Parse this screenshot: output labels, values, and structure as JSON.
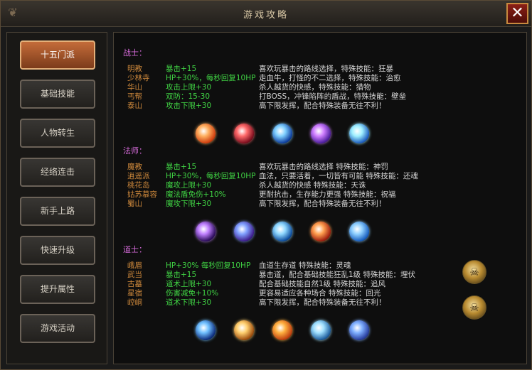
{
  "window": {
    "title": "游戏攻略",
    "close_label": "✕"
  },
  "sidebar": {
    "items": [
      {
        "label": "十五门派",
        "active": true
      },
      {
        "label": "基础技能"
      },
      {
        "label": "人物转生"
      },
      {
        "label": "经络连击"
      },
      {
        "label": "新手上路"
      },
      {
        "label": "快速升级"
      },
      {
        "label": "提升属性"
      },
      {
        "label": "游戏活动"
      }
    ]
  },
  "sections": [
    {
      "title": "战士：",
      "rows": [
        {
          "name": "明教",
          "stat": "暴击+15",
          "desc": "喜欢玩暴击的路线选择，特殊技能：狂暴"
        },
        {
          "name": "少林寺",
          "stat": "HP+30%，每秒回复10HP",
          "desc": "走血牛，打怪的不二选择，特殊技能：治愈"
        },
        {
          "name": "华山",
          "stat": "攻击上限+30",
          "desc": "杀人越货的快感，特殊技能：猎物"
        },
        {
          "name": "丐帮",
          "stat": "双防：15-30",
          "desc": "打BOSS，冲锋陷阵的盾战，特殊技能：壁垒"
        },
        {
          "name": "泰山",
          "stat": "攻击下限+30",
          "desc": "高下限发挥，配合特殊装备无往不利！"
        }
      ],
      "skills": [
        "fire-claw-skill-icon",
        "red-slash-skill-icon",
        "blue-burst-skill-icon",
        "purple-armor-skill-icon",
        "ice-sword-skill-icon"
      ]
    },
    {
      "title": "法师：",
      "rows": [
        {
          "name": "魔教",
          "stat": "暴击+15",
          "desc": "喜欢玩暴击的路线选择  特殊技能：神罚"
        },
        {
          "name": "逍遥派",
          "stat": "HP+30%，每秒回复10HP",
          "desc": "血法，只要活着，一切皆有可能  特殊技能：还魂"
        },
        {
          "name": "桃花岛",
          "stat": "魔攻上限+30",
          "desc": "杀人越货的快感    特殊技能：天诛"
        },
        {
          "name": "姑苏慕容",
          "stat": "魔法盾免伤+10%",
          "desc": "更耐抗击，生存能力更强    特殊技能：祝福"
        },
        {
          "name": "蜀山",
          "stat": "魔攻下限+30",
          "desc": "高下限发挥，配合特殊装备无往不利！"
        }
      ],
      "skills": [
        "purple-lightning-skill-icon",
        "blue-purple-orb-skill-icon",
        "blue-blast-skill-icon",
        "fire-wing-skill-icon",
        "blue-comet-skill-icon"
      ]
    },
    {
      "title": "道士：",
      "rows": [
        {
          "name": "峨眉",
          "stat": "HP+30% 每秒回复10HP",
          "desc": "血道生存道  特殊技能：灵魂"
        },
        {
          "name": "武当",
          "stat": "暴击+15",
          "desc": "暴击道，配合基础技能狂乱1级  特殊技能：埋伏"
        },
        {
          "name": "古墓",
          "stat": "道术上限+30",
          "desc": "配合基础技能自然1级  特殊技能：追风"
        },
        {
          "name": "星宿",
          "stat": "伤害减免+10%",
          "desc": "更容易适应各种场合    特殊技能：回光"
        },
        {
          "name": "崆峒",
          "stat": "道术下限+30",
          "desc": "高下限发挥，配合特殊装备无往不利！"
        }
      ],
      "skills": [
        "blue-vortex-skill-icon",
        "golden-figure-skill-icon",
        "fire-runner-skill-icon",
        "blue-splash-skill-icon",
        "blue-cloud-skill-icon"
      ],
      "side_orbs": [
        "golden-skeleton-icon",
        "golden-skeleton-icon"
      ]
    }
  ]
}
